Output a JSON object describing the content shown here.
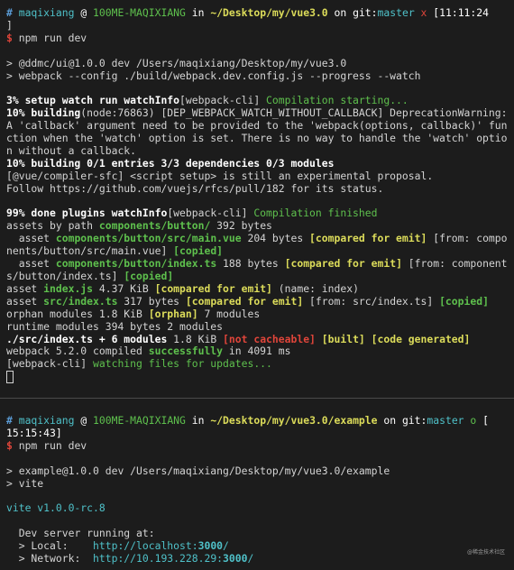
{
  "top": {
    "prompt": {
      "hash": "#",
      "user": "maqixiang",
      "at": "@",
      "host": "100ME-MAQIXIANG",
      "in": "in",
      "path": "~/Desktop/my/vue3.0",
      "on": "on",
      "git_label": "git:",
      "branch": "master",
      "dirty": "x",
      "time": "[11:11:24",
      "time_close": "]"
    },
    "dollar": "$",
    "command": "npm run dev",
    "script_line1": "> @ddmc/ui@1.0.0 dev /Users/maqixiang/Desktop/my/vue3.0",
    "script_line2": "> webpack --config ./build/webpack.dev.config.js --progress --watch",
    "l_setup_bold": "3% setup watch run watchInfo",
    "l_setup_cli": "[webpack-cli]",
    "l_setup_msg": " Compilation starting...",
    "l_building_bold": "10% building",
    "l_building_text": "(node:76863) [DEP_WEBPACK_WATCH_WITHOUT_CALLBACK] DeprecationWarning: A 'callback' argument need to be provided to the 'webpack(options, callback)' function when the 'watch' option is set. There is no way to handle the 'watch' option without a callback.",
    "l_entries": "10% building 0/1 entries 3/3 dependencies 0/3 modules",
    "l_sfc1": "[@vue/compiler-sfc] <script setup> is still an experimental proposal.",
    "l_sfc2": "Follow https://github.com/vuejs/rfcs/pull/182 for its status.",
    "l_done_bold": "99% done plugins watchInfo",
    "l_done_cli": "[webpack-cli]",
    "l_done_msg": " Compilation finished",
    "l_assets_pre": "assets by path ",
    "l_assets_path": "components/button/",
    "l_assets_post": " 392 bytes",
    "a1_pre": "  asset ",
    "a1_name": "components/button/src/main.vue",
    "a1_size": " 204 bytes ",
    "a1_cmp": "[compared for emit]",
    "a1_from": " [from: components/button/src/main.vue] ",
    "a1_copied": "[copied]",
    "a2_pre": "  asset ",
    "a2_name": "components/button/index.ts",
    "a2_size": " 188 bytes ",
    "a2_cmp": "[compared for emit]",
    "a2_from": " [from: components/button/index.ts] ",
    "a2_copied": "[copied]",
    "a3_pre": "asset ",
    "a3_name": "index.js",
    "a3_size": " 4.37 KiB ",
    "a3_cmp": "[compared for emit]",
    "a3_rest": " (name: index)",
    "a4_pre": "asset ",
    "a4_name": "src/index.ts",
    "a4_size": " 317 bytes ",
    "a4_cmp": "[compared for emit]",
    "a4_from": " [from: src/index.ts] ",
    "a4_copied": "[copied]",
    "orphan_pre": "orphan modules 1.8 KiB ",
    "orphan_tag": "[orphan]",
    "orphan_post": " 7 modules",
    "runtime": "runtime modules 394 bytes 2 modules",
    "src_bold": "./src/index.ts + 6 modules",
    "src_size": " 1.8 KiB ",
    "src_notcache": "[not cacheable]",
    "src_sp1": " ",
    "src_built": "[built]",
    "src_sp2": " ",
    "src_gen": "[code generated]",
    "compiled_pre": "webpack 5.2.0 compiled ",
    "compiled_ok": "successfully",
    "compiled_post": " in 4091 ms",
    "watch_cli": "[webpack-cli]",
    "watch_msg": " watching files for updates..."
  },
  "bottom": {
    "prompt": {
      "hash": "#",
      "user": "maqixiang",
      "at": "@",
      "host": "100ME-MAQIXIANG",
      "in": "in",
      "path": "~/Desktop/my/vue3.0/example",
      "on": "on",
      "git_label": "git:",
      "branch": "master",
      "dirty": "o",
      "time": "[",
      "time2": "15:15:43]"
    },
    "dollar": "$",
    "command": "npm run dev",
    "script_line1": "> example@1.0.0 dev /Users/maqixiang/Desktop/my/vue3.0/example",
    "script_line2": "> vite",
    "vite_version": "vite v1.0.0-rc.8",
    "dev_running": "  Dev server running at:",
    "local_label": "  > Local:    ",
    "local_url_pre": "http://localhost:",
    "local_port": "3000",
    "local_url_post": "/",
    "net_label": "  > Network:  ",
    "net_url_pre": "http://10.193.228.29:",
    "net_port": "3000",
    "net_url_post": "/"
  },
  "watermark": "@稀金技术社区",
  "colors": {
    "background": "#1c1c1c",
    "prompt_blue": "#5a9bd5",
    "success_green": "#5ec04d",
    "tag_yellow": "#dcdc5a",
    "error_red": "#e0453a",
    "branch_cyan": "#4fc1c9"
  }
}
